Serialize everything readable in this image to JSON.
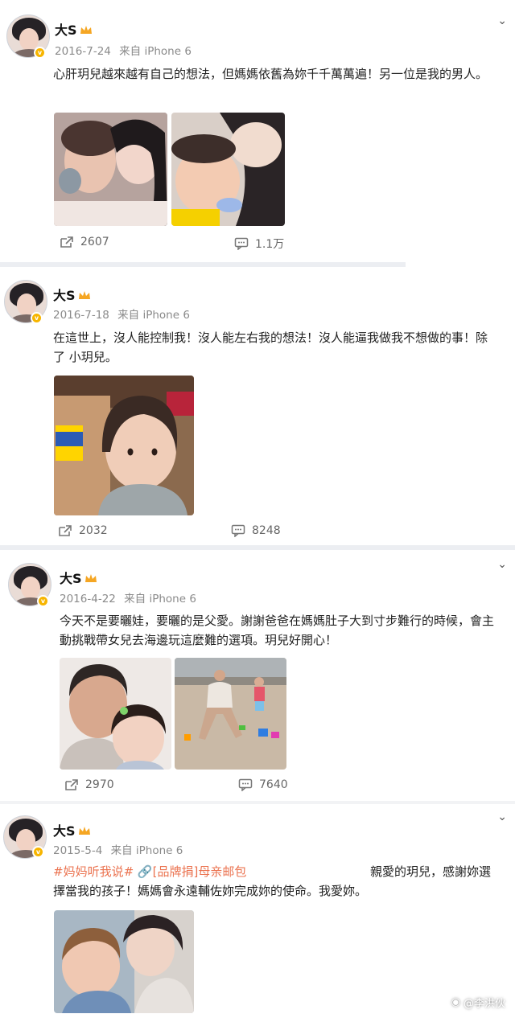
{
  "posts": [
    {
      "name": "大S",
      "date": "2016-7-24",
      "source": "来自 iPhone 6",
      "text": "心肝玥兒越來越有自己的想法，但媽媽依舊為妳千千萬萬遍！另一位是我的男人。",
      "reposts": "2607",
      "comments": "1.1万"
    },
    {
      "name": "大S",
      "date": "2016-7-18",
      "source": "来自 iPhone 6",
      "text_line1": "在這世上，沒人能控制我！沒人能左右我的想法！沒人能逼我做我不想做的事！除",
      "text_line2": "了 小玥兒。",
      "reposts": "2032",
      "comments": "8248"
    },
    {
      "name": "大S",
      "date": "2016-4-22",
      "source": "来自 iPhone 6",
      "text_line1": "今天不是要曬娃，要曬的是父愛。謝謝爸爸在媽媽肚子大到寸步難行的時候，會主",
      "text_line2": "動挑戰帶女兒去海邊玩這麼難的選項。玥兒好開心！",
      "reposts": "2970",
      "comments": "7640"
    },
    {
      "name": "大S",
      "date": "2015-5-4",
      "source": "来自 iPhone 6",
      "tag": "#妈妈听我说#",
      "link": "[品牌捐]母亲邮包",
      "text_line1": "親愛的玥兒，感謝妳選",
      "text_line2": "擇當我的孩子！媽媽會永遠輔佐妳完成妳的使命。我愛妳。"
    }
  ],
  "watermark": "@李洪伙",
  "colors": {
    "tag": "#eb7350",
    "badge": "#f7b500",
    "separator": "#eceef2"
  }
}
